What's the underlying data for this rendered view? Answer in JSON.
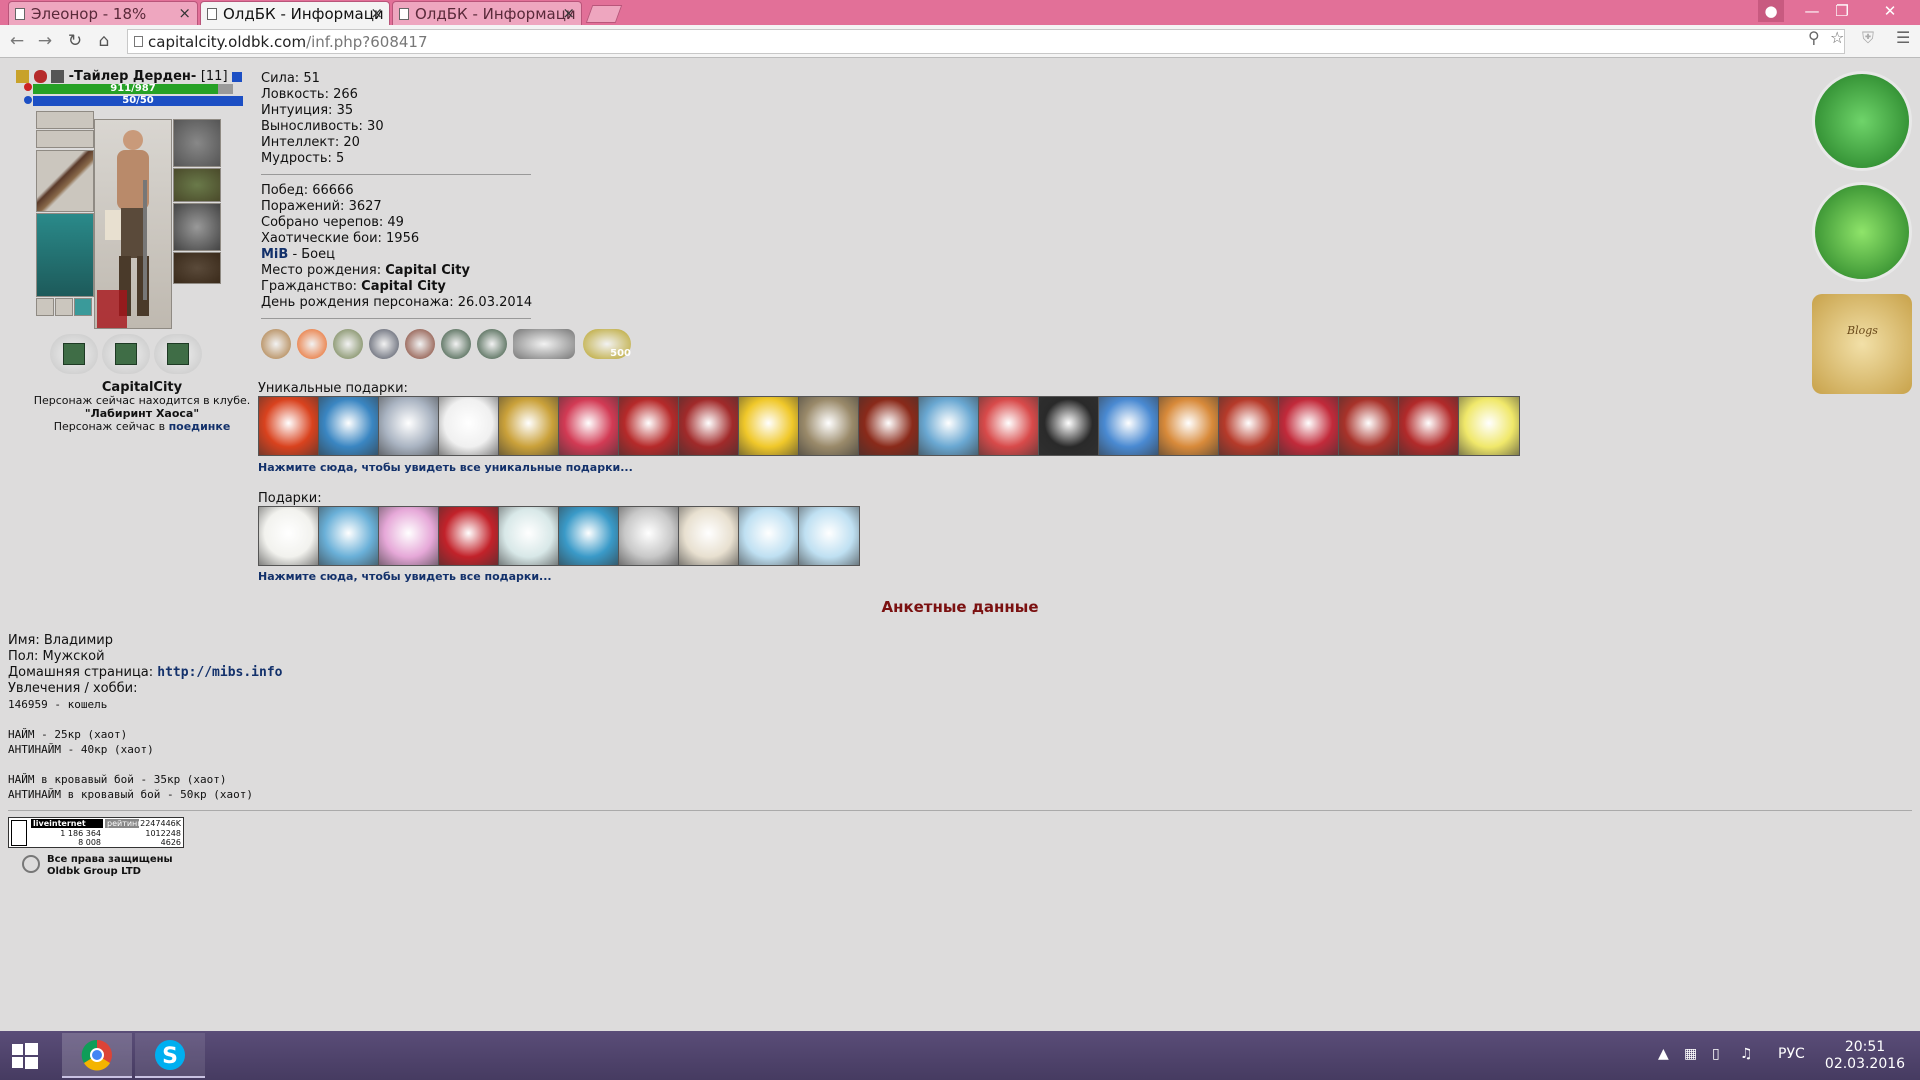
{
  "browser": {
    "tabs": [
      {
        "title": "Элеонор - 18%",
        "active": false
      },
      {
        "title": "ОлдБК - Информаци",
        "active": true
      },
      {
        "title": "ОлдБК - Информаци",
        "active": false
      }
    ],
    "url_host": "capitalcity.oldbk.com",
    "url_path": "/inf.php?608417",
    "close_glyph": "×"
  },
  "character": {
    "name": "-Тайлер Дерден-",
    "level": "[11]",
    "hp": "911/987",
    "hp_fraction": 0.923,
    "mana": "50/50",
    "mana_fraction": 1.0,
    "city": "CapitalCity",
    "location_line1": "Персонаж сейчас находится в клубе.",
    "location_club": "\"Лабиринт Хаоса\"",
    "location_line3_prefix": "Персонаж сейчас в",
    "location_line3_link": "поединке"
  },
  "stats": {
    "strength": "Сила: 51",
    "agility": "Ловкость: 266",
    "intuition": "Интуиция: 35",
    "endurance": "Выносливость: 30",
    "intellect": "Интеллект: 20",
    "wisdom": "Мудрость: 5",
    "wins": "Побед: 66666",
    "losses": "Поражений: 3627",
    "skulls": "Собрано черепов: 49",
    "chaos": "Хаотические бои: 1956",
    "clan_name": "MiB",
    "clan_role": " - Боец",
    "birthplace_label": "Место рождения: ",
    "birthplace": "Capital City",
    "citizenship_label": "Гражданство: ",
    "citizenship": "Capital City",
    "birthday": "День рождения персонажа: 26.03.2014"
  },
  "badges": [
    {
      "icon": "ring-badge-icon",
      "color": "#a8763b"
    },
    {
      "icon": "pumpkin-badge-icon",
      "color": "#e8621c"
    },
    {
      "icon": "swords-badge-icon",
      "color": "#6c7c4a"
    },
    {
      "icon": "shield-badge-icon",
      "color": "#4a4f5e"
    },
    {
      "icon": "star-badge-icon",
      "color": "#7d3b2a"
    },
    {
      "icon": "emblem-badge-icon",
      "color": "#2f4d36"
    },
    {
      "icon": "emblem2-badge-icon",
      "color": "#2f4d36"
    },
    {
      "icon": "car-badge-icon",
      "color": "#777777"
    },
    {
      "icon": "500-badge-icon",
      "color": "#b8a32a",
      "label": "500"
    }
  ],
  "unique_gifts": {
    "title": "Уникальные подарки:",
    "link": "Нажмите сюда, чтобы увидеть все уникальные подарки...",
    "colors": [
      "#d9421e",
      "#3a86c2",
      "#aab4c2",
      "#f0f0f0",
      "#caa13a",
      "#d23a54",
      "#b62a2a",
      "#a12a2a",
      "#f0c82a",
      "#9a8a6a",
      "#8a2a1a",
      "#6aa8d2",
      "#d84a4a",
      "#2a2a2a",
      "#4a8ad2",
      "#d88a3a",
      "#b63a2a",
      "#c22a3a",
      "#a8322a",
      "#b22a2a",
      "#f0e86a"
    ]
  },
  "gifts": {
    "title": "Подарки:",
    "link": "Нажмите сюда, чтобы увидеть все подарки...",
    "colors": [
      "#f2f2ee",
      "#6ab0d8",
      "#e6a8d8",
      "#c2222a",
      "#d8e8e8",
      "#3a9ac8",
      "#c8c8c8",
      "#e8e0d0",
      "#bfe0f2",
      "#bfe0f2"
    ]
  },
  "profile": {
    "heading": "Анкетные данные",
    "name": "Имя: Владимир",
    "gender": "Пол: Мужской",
    "homepage_label": "Домашняя страница: ",
    "homepage": "http://mibs.info",
    "hobby_label": "Увлечения / хобби:",
    "hobby_lines": [
      "146959 - кошель",
      "",
      "НАЙМ - 25кр (хаот)",
      "АНТИНАЙМ - 40кр (хаот)",
      "",
      "НАЙМ в кровавый бой - 35кр (хаот)",
      "АНТИНАЙМ в кровавый бой - 50кр (хаот)"
    ]
  },
  "footer": {
    "counter_left": "liveinternet",
    "counter_left_n1": "1 186 364",
    "counter_left_n2": "8 008",
    "counter_right": "рейтинг",
    "counter_right_n1": "2247446K",
    "counter_right_n2": "1012248",
    "counter_right_n3": "4626",
    "copyright_line1": "Все права защищены",
    "copyright_line2": "Oldbk Group LTD"
  },
  "medals": [
    {
      "icon": "zodiac-taurus-icon",
      "color": "#2e9b32"
    },
    {
      "icon": "leaf-icon",
      "color": "#2e9b32"
    },
    {
      "icon": "blogs-scroll-icon",
      "color": "#d8b45a",
      "label": "Blogs"
    }
  ],
  "taskbar": {
    "apps": [
      {
        "icon": "chrome-icon"
      },
      {
        "icon": "skype-icon"
      }
    ],
    "lang": "РУС",
    "time": "20:51",
    "date": "02.03.2016"
  }
}
